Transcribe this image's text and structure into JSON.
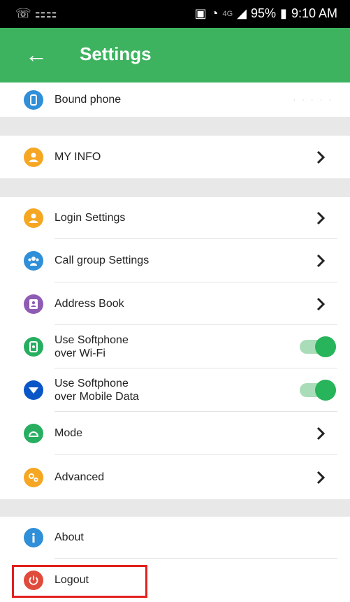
{
  "status_bar": {
    "left_icons": "☏ ⚏⚏",
    "network": "4G",
    "battery": "95%",
    "time": "9:10 AM"
  },
  "header": {
    "title": "Settings",
    "back_icon": "arrow-left-icon"
  },
  "colors": {
    "header_bg": "#3db35f",
    "orange": "#f5a623",
    "blue": "#2f8fd8",
    "purple": "#8e5bb5",
    "green": "#27ae60",
    "navy": "#0a56c7",
    "toggle_on": "#28b45a",
    "logout_red": "#e04b3c",
    "highlight": "#e32020"
  },
  "items": {
    "bound_phone": {
      "label": "Bound phone",
      "value": "· · · · ·"
    },
    "my_info": {
      "label": "MY INFO"
    },
    "login_settings": {
      "label": "Login Settings"
    },
    "call_group": {
      "label": "Call group Settings"
    },
    "address_book": {
      "label": "Address Book"
    },
    "softphone_wifi": {
      "line1": "Use Softphone",
      "line2": "over Wi-Fi",
      "enabled": true
    },
    "softphone_mobile": {
      "line1": "Use Softphone",
      "line2": "over Mobile Data",
      "enabled": true
    },
    "mode": {
      "label": "Mode"
    },
    "advanced": {
      "label": "Advanced"
    },
    "about": {
      "label": "About"
    },
    "logout": {
      "label": "Logout"
    }
  }
}
